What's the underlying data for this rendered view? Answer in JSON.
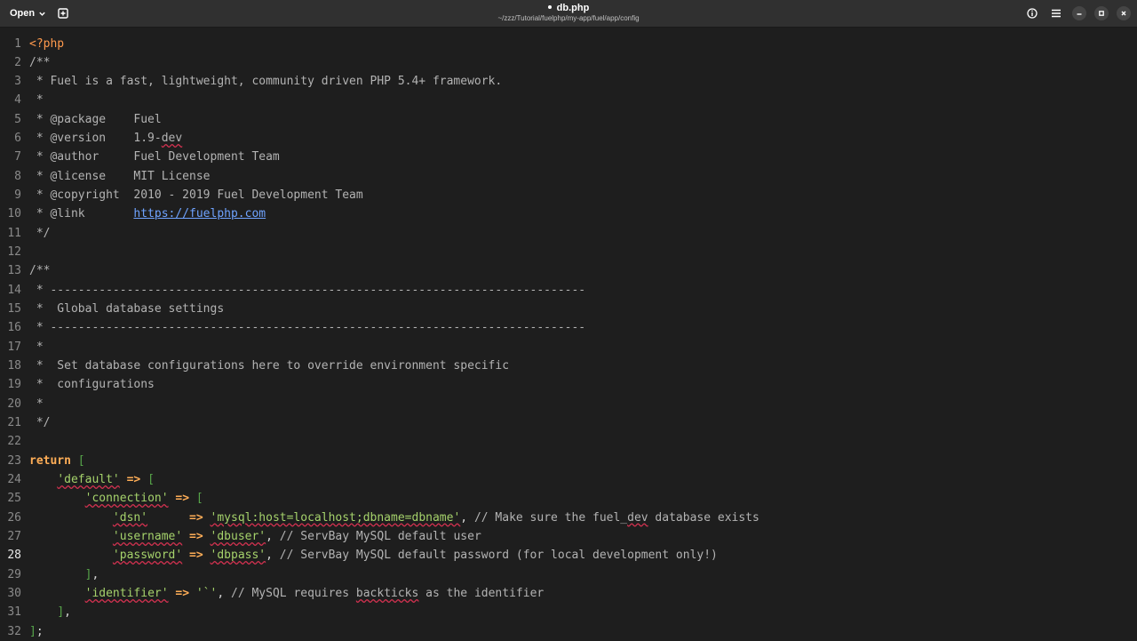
{
  "header": {
    "open_label": "Open",
    "title": "db.php",
    "path": "~/zzz/Tutorial/fuelphp/my-app/fuel/app/config"
  },
  "editor": {
    "current_line": 28,
    "lines": [
      {
        "n": "1",
        "segments": [
          {
            "t": "<?php",
            "c": "tag"
          }
        ]
      },
      {
        "n": "2",
        "segments": [
          {
            "t": "/**",
            "c": "com"
          }
        ]
      },
      {
        "n": "3",
        "segments": [
          {
            "t": " * Fuel is a fast, lightweight, community driven PHP 5.4+ framework.",
            "c": "com"
          }
        ]
      },
      {
        "n": "4",
        "segments": [
          {
            "t": " *",
            "c": "com"
          }
        ]
      },
      {
        "n": "5",
        "segments": [
          {
            "t": " * @package    Fuel",
            "c": "com"
          }
        ]
      },
      {
        "n": "6",
        "segments": [
          {
            "t": " * @version    1.9-",
            "c": "com"
          },
          {
            "t": "dev",
            "c": "com sq"
          }
        ]
      },
      {
        "n": "7",
        "segments": [
          {
            "t": " * @author     Fuel Development Team",
            "c": "com"
          }
        ]
      },
      {
        "n": "8",
        "segments": [
          {
            "t": " * @license    MIT License",
            "c": "com"
          }
        ]
      },
      {
        "n": "9",
        "segments": [
          {
            "t": " * @copyright  2010 - 2019 Fuel Development Team",
            "c": "com"
          }
        ]
      },
      {
        "n": "10",
        "segments": [
          {
            "t": " * @link       ",
            "c": "com"
          },
          {
            "t": "https://fuelphp.com",
            "c": "link"
          }
        ]
      },
      {
        "n": "11",
        "segments": [
          {
            "t": " */",
            "c": "com"
          }
        ]
      },
      {
        "n": "12",
        "segments": []
      },
      {
        "n": "13",
        "segments": [
          {
            "t": "/**",
            "c": "com"
          }
        ]
      },
      {
        "n": "14",
        "segments": [
          {
            "t": " * -----------------------------------------------------------------------------",
            "c": "com"
          }
        ]
      },
      {
        "n": "15",
        "segments": [
          {
            "t": " *  Global database settings",
            "c": "com"
          }
        ]
      },
      {
        "n": "16",
        "segments": [
          {
            "t": " * -----------------------------------------------------------------------------",
            "c": "com"
          }
        ]
      },
      {
        "n": "17",
        "segments": [
          {
            "t": " *",
            "c": "com"
          }
        ]
      },
      {
        "n": "18",
        "segments": [
          {
            "t": " *  Set database configurations here to override environment specific",
            "c": "com"
          }
        ]
      },
      {
        "n": "19",
        "segments": [
          {
            "t": " *  configurations",
            "c": "com"
          }
        ]
      },
      {
        "n": "20",
        "segments": [
          {
            "t": " *",
            "c": "com"
          }
        ]
      },
      {
        "n": "21",
        "segments": [
          {
            "t": " */",
            "c": "com"
          }
        ]
      },
      {
        "n": "22",
        "segments": []
      },
      {
        "n": "23",
        "segments": [
          {
            "t": "return",
            "c": "kw"
          },
          {
            "t": " ",
            "c": "pun"
          },
          {
            "t": "[",
            "c": "br"
          }
        ]
      },
      {
        "n": "24",
        "segments": [
          {
            "t": "    ",
            "c": "pun"
          },
          {
            "t": "'default'",
            "c": "str"
          },
          {
            "t": " ",
            "c": "pun"
          },
          {
            "t": "=>",
            "c": "op"
          },
          {
            "t": " ",
            "c": "pun"
          },
          {
            "t": "[",
            "c": "br"
          }
        ]
      },
      {
        "n": "25",
        "segments": [
          {
            "t": "        ",
            "c": "pun"
          },
          {
            "t": "'connection'",
            "c": "str"
          },
          {
            "t": " ",
            "c": "pun"
          },
          {
            "t": "=>",
            "c": "op"
          },
          {
            "t": " ",
            "c": "pun"
          },
          {
            "t": "[",
            "c": "br"
          }
        ]
      },
      {
        "n": "26",
        "segments": [
          {
            "t": "            ",
            "c": "pun"
          },
          {
            "t": "'dsn'",
            "c": "str"
          },
          {
            "t": "      ",
            "c": "pun"
          },
          {
            "t": "=>",
            "c": "op"
          },
          {
            "t": " ",
            "c": "pun"
          },
          {
            "t": "'mysql:host=localhost;dbname=dbname'",
            "c": "str"
          },
          {
            "t": ", ",
            "c": "pun"
          },
          {
            "t": "// Make sure the fuel_",
            "c": "com"
          },
          {
            "t": "dev",
            "c": "com sq"
          },
          {
            "t": " database exists",
            "c": "com"
          }
        ]
      },
      {
        "n": "27",
        "segments": [
          {
            "t": "            ",
            "c": "pun"
          },
          {
            "t": "'username'",
            "c": "str"
          },
          {
            "t": " ",
            "c": "pun"
          },
          {
            "t": "=>",
            "c": "op"
          },
          {
            "t": " ",
            "c": "pun"
          },
          {
            "t": "'dbuser'",
            "c": "str"
          },
          {
            "t": ", ",
            "c": "pun"
          },
          {
            "t": "// ServBay MySQL default user",
            "c": "com"
          }
        ]
      },
      {
        "n": "28",
        "segments": [
          {
            "t": "            ",
            "c": "pun"
          },
          {
            "t": "'password'",
            "c": "str"
          },
          {
            "t": " ",
            "c": "pun"
          },
          {
            "t": "=>",
            "c": "op"
          },
          {
            "t": " ",
            "c": "pun"
          },
          {
            "t": "'dbpass'",
            "c": "str"
          },
          {
            "t": ", ",
            "c": "pun"
          },
          {
            "t": "// ServBay MySQL default password (for local development only!)",
            "c": "com"
          }
        ]
      },
      {
        "n": "29",
        "segments": [
          {
            "t": "        ",
            "c": "pun"
          },
          {
            "t": "]",
            "c": "br"
          },
          {
            "t": ",",
            "c": "pun"
          }
        ]
      },
      {
        "n": "30",
        "segments": [
          {
            "t": "        ",
            "c": "pun"
          },
          {
            "t": "'identifier'",
            "c": "str"
          },
          {
            "t": " ",
            "c": "pun"
          },
          {
            "t": "=>",
            "c": "op"
          },
          {
            "t": " ",
            "c": "pun"
          },
          {
            "t": "'`'",
            "c": "strp"
          },
          {
            "t": ", ",
            "c": "pun"
          },
          {
            "t": "// MySQL requires ",
            "c": "com"
          },
          {
            "t": "backticks",
            "c": "com sq"
          },
          {
            "t": " as the identifier",
            "c": "com"
          }
        ]
      },
      {
        "n": "31",
        "segments": [
          {
            "t": "    ",
            "c": "pun"
          },
          {
            "t": "]",
            "c": "br"
          },
          {
            "t": ",",
            "c": "pun"
          }
        ]
      },
      {
        "n": "32",
        "segments": [
          {
            "t": "]",
            "c": "br"
          },
          {
            "t": ";",
            "c": "pun"
          }
        ]
      }
    ]
  }
}
